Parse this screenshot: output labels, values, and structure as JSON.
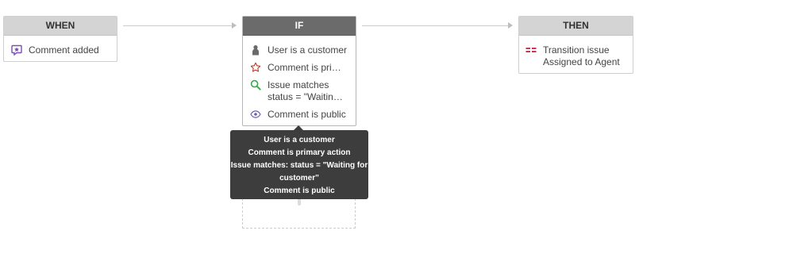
{
  "when": {
    "title": "WHEN",
    "items": [
      {
        "icon": "comment-icon",
        "label": "Comment added"
      }
    ]
  },
  "if": {
    "title": "IF",
    "items": [
      {
        "icon": "user-icon",
        "label": "User is a customer"
      },
      {
        "icon": "star-icon",
        "label": "Comment is prim…"
      },
      {
        "icon": "search-icon",
        "label_line1": "Issue matches",
        "label_line2": "status = \"Waiting …"
      },
      {
        "icon": "eye-icon",
        "label": "Comment is public"
      }
    ]
  },
  "then": {
    "title": "THEN",
    "items": [
      {
        "icon": "transition-icon",
        "label_line1": "Transition issue",
        "label_line2": "Assigned to Agent"
      }
    ]
  },
  "tooltip": {
    "lines": [
      "User is a customer",
      "Comment is primary action",
      "Issue matches: status = \"Waiting for",
      "customer\"",
      "Comment is public"
    ]
  },
  "colors": {
    "if_header": "#6b6b6b",
    "header": "#d4d4d4",
    "tooltip_bg": "#3d3d3d",
    "comment_icon": "#7a4fb3",
    "star_icon": "#c0392b",
    "search_icon": "#3aa84a",
    "eye_icon": "#6a5fb0",
    "transition_icon": "#cc3355"
  }
}
